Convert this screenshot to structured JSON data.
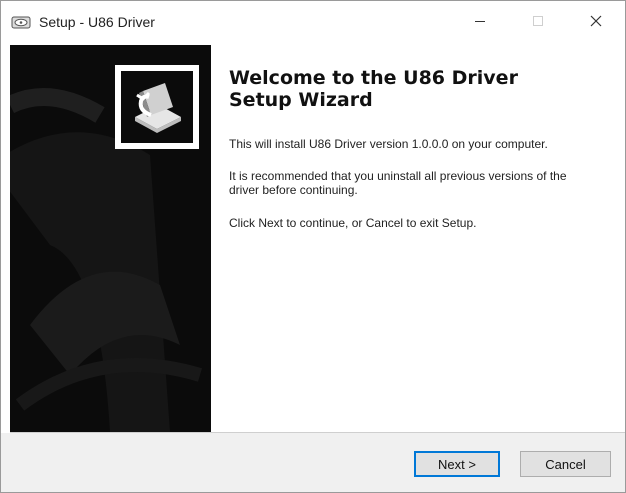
{
  "window": {
    "title": "Setup - U86 Driver",
    "app_icon": "setup-disk-icon"
  },
  "titlebar_buttons": {
    "minimize_icon": "minimize-icon",
    "maximize_icon": "maximize-icon",
    "close_icon": "close-icon"
  },
  "banner": {
    "logo_icon": "installer-box-icon"
  },
  "content": {
    "heading": "Welcome to the U86 Driver\nSetup Wizard",
    "paragraph_1": "This will install U86 Driver version 1.0.0.0 on your computer.",
    "paragraph_2": "It is recommended that you uninstall all previous versions of the driver before continuing.",
    "paragraph_3": "Click Next to continue, or Cancel to exit Setup."
  },
  "buttons": {
    "next_label": "Next >",
    "cancel_label": "Cancel"
  },
  "colors": {
    "banner_bg": "#0b0b0b",
    "footer_bg": "#f0f0f0",
    "focus_border": "#0078d7"
  }
}
